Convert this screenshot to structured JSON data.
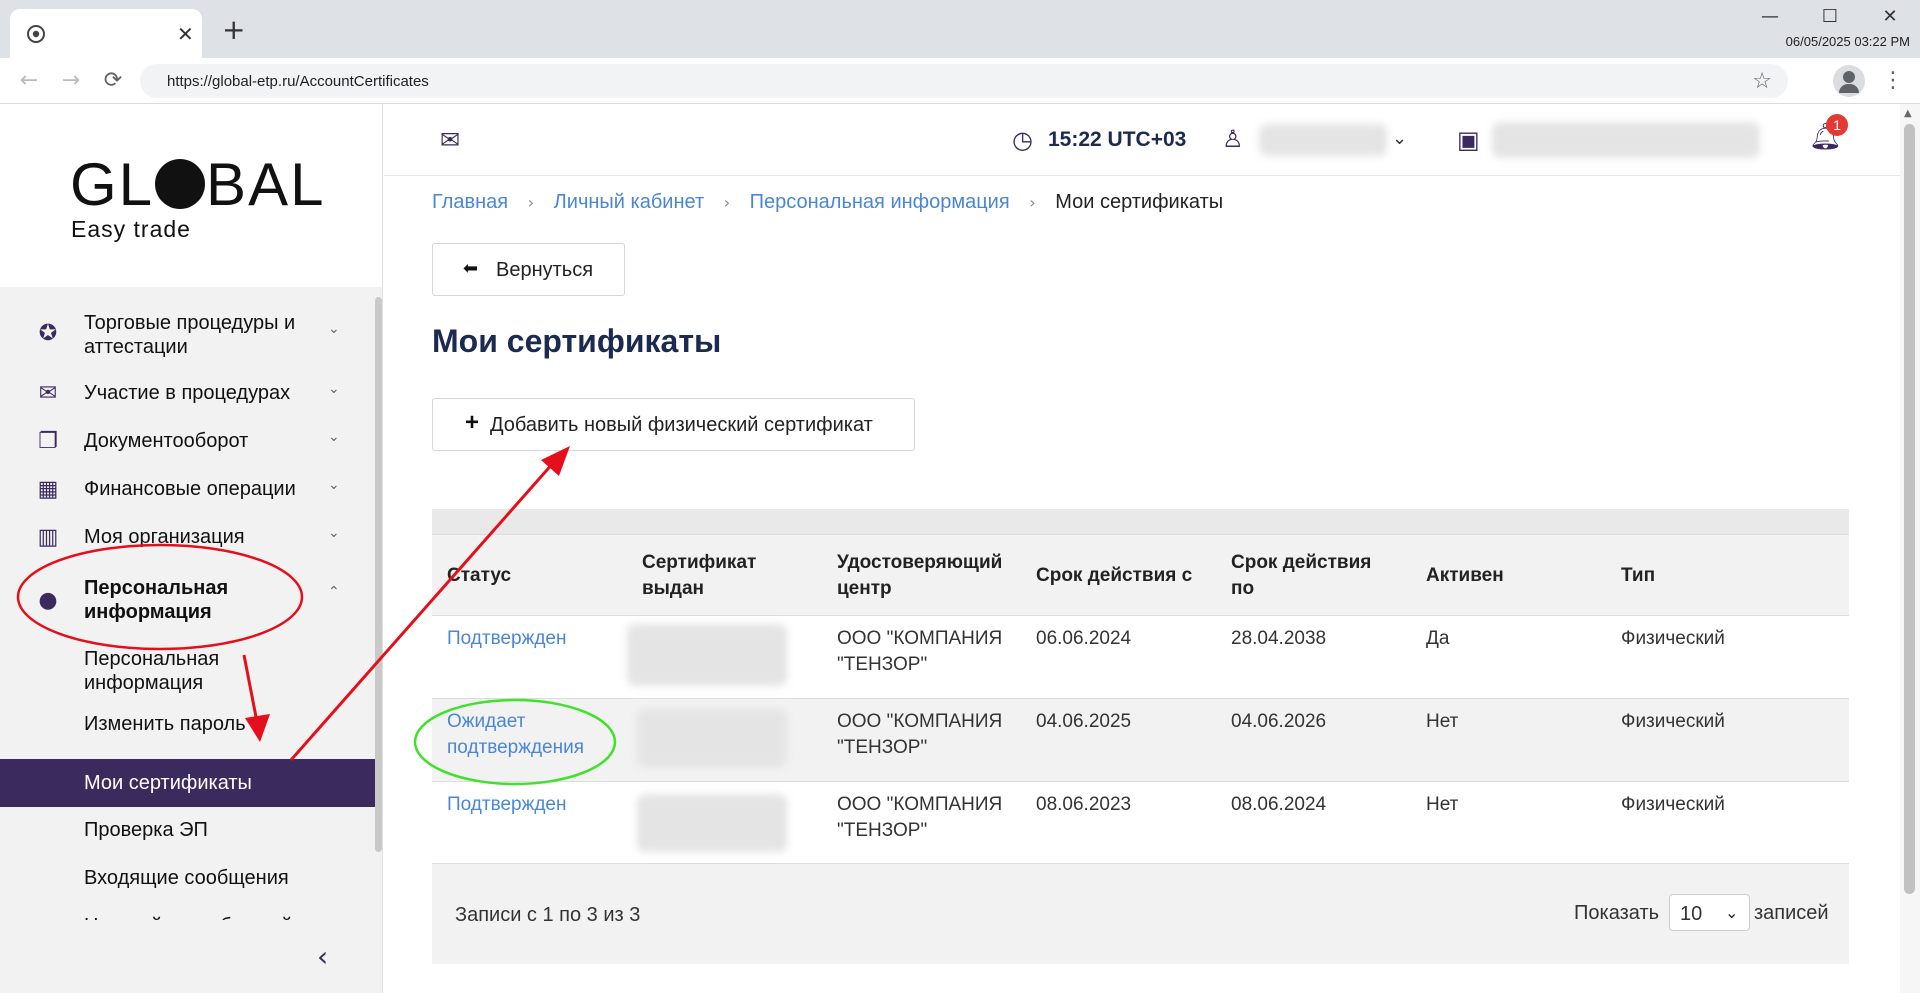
{
  "browser": {
    "url": "https://global-etp.ru/AccountCertificates",
    "datetime": "06/05/2025 03:22 PM",
    "tab_close": "✕",
    "new_tab": "+",
    "win_minimize": "—",
    "win_maximize": "☐",
    "win_close": "✕",
    "back": "←",
    "forward": "→",
    "reload": "⟳",
    "star": "☆",
    "menu": "⋮"
  },
  "sidebar": {
    "logo_main_1": "GL",
    "logo_main_2": "BAL",
    "logo_sub": "Easy trade",
    "items": [
      {
        "label": "Торговые процедуры и аттестации",
        "icon": "award-icon",
        "chev": "⌄"
      },
      {
        "label": "Участие в процедурах",
        "icon": "envelope-icon",
        "chev": "⌄"
      },
      {
        "label": "Документооборот",
        "icon": "documents-icon",
        "chev": "⌄"
      },
      {
        "label": "Финансовые операции",
        "icon": "calculator-icon",
        "chev": "⌄"
      },
      {
        "label": "Моя организация",
        "icon": "building-icon",
        "chev": "⌄"
      },
      {
        "label": "Персональная информация",
        "icon": "person-icon",
        "chev": "⌃"
      }
    ],
    "sub_items": [
      {
        "label": "Персональная информация"
      },
      {
        "label": "Изменить пароль"
      },
      {
        "label": "Мои сертификаты"
      },
      {
        "label": "Проверка ЭП"
      },
      {
        "label": "Входящие сообщения"
      },
      {
        "label": "Настройки сообщений"
      }
    ],
    "collapse": "‹"
  },
  "header": {
    "time": "15:22 UTC+03",
    "notification_count": "1"
  },
  "breadcrumbs": {
    "home": "Главная",
    "cabinet": "Личный кабинет",
    "personal": "Персональная информация",
    "current": "Мои сертификаты",
    "sep": "›"
  },
  "main": {
    "back_label": "Вернуться",
    "title": "Мои сертификаты",
    "add_label": "Добавить новый физический сертификат"
  },
  "table": {
    "headers": [
      "Статус",
      "Сертификат выдан",
      "Удостоверяющий центр",
      "Срок действия с",
      "Срок действия по",
      "Активен",
      "Тип"
    ],
    "rows": [
      {
        "status": "Подтвержден",
        "ca": "ООО \"КОМПАНИЯ \"ТЕНЗОР\"",
        "from": "06.06.2024",
        "to": "28.04.2038",
        "active": "Да",
        "type": "Физический"
      },
      {
        "status": "Ожидает подтверждения",
        "ca": "ООО \"КОМПАНИЯ \"ТЕНЗОР\"",
        "from": "04.06.2025",
        "to": "04.06.2026",
        "active": "Нет",
        "type": "Физический"
      },
      {
        "status": "Подтвержден",
        "ca": "ООО \"КОМПАНИЯ \"ТЕНЗОР\"",
        "from": "08.06.2023",
        "to": "08.06.2024",
        "active": "Нет",
        "type": "Физический"
      }
    ],
    "records_text": "Записи с 1 по 3 из 3",
    "show_label": "Показать",
    "page_size": "10",
    "entries_label": "записей"
  },
  "colors": {
    "accent": "#3b2a5e",
    "link": "#4a86d6",
    "title": "#1b2a4e",
    "annotation_red": "#e3101b",
    "annotation_green": "#3ee22a"
  }
}
